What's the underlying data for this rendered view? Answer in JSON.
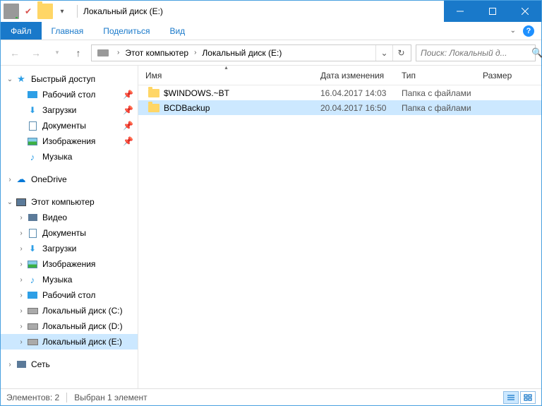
{
  "title": "Локальный диск (E:)",
  "tabs": {
    "file": "Файл",
    "home": "Главная",
    "share": "Поделиться",
    "view": "Вид"
  },
  "breadcrumb": {
    "pc": "Этот компьютер",
    "drive": "Локальный диск (E:)"
  },
  "search": {
    "placeholder": "Поиск: Локальный д..."
  },
  "columns": {
    "name": "Имя",
    "date": "Дата изменения",
    "type": "Тип",
    "size": "Размер"
  },
  "rows": [
    {
      "name": "$WINDOWS.~BT",
      "date": "16.04.2017 14:03",
      "type": "Папка с файлами",
      "size": ""
    },
    {
      "name": "BCDBackup",
      "date": "20.04.2017 16:50",
      "type": "Папка с файлами",
      "size": ""
    }
  ],
  "nav": {
    "quick": "Быстрый доступ",
    "desktop": "Рабочий стол",
    "downloads": "Загрузки",
    "documents": "Документы",
    "pictures": "Изображения",
    "music": "Музыка",
    "onedrive": "OneDrive",
    "thispc": "Этот компьютер",
    "video": "Видео",
    "documents2": "Документы",
    "downloads2": "Загрузки",
    "pictures2": "Изображения",
    "music2": "Музыка",
    "desktop2": "Рабочий стол",
    "drivec": "Локальный диск (C:)",
    "drived": "Локальный диск (D:)",
    "drivee": "Локальный диск (E:)",
    "network": "Сеть"
  },
  "status": {
    "items": "Элементов: 2",
    "selected": "Выбран 1 элемент"
  }
}
